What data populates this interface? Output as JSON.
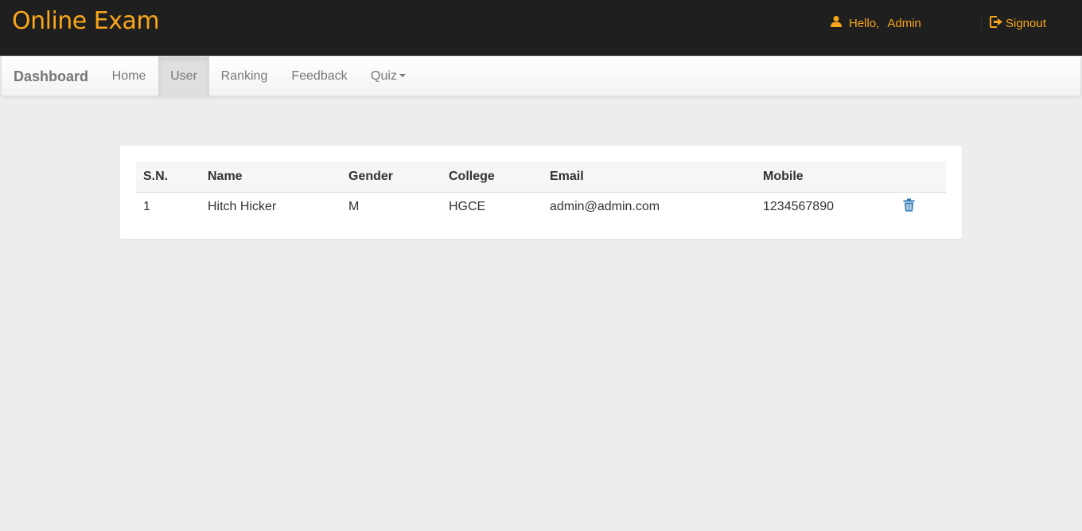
{
  "header": {
    "brand": "Online Exam",
    "greeting": "Hello,",
    "username": "Admin",
    "signout_label": "Signout",
    "accent_color": "#f8a61c",
    "icons": {
      "user": "user-icon",
      "signout": "signout-icon"
    }
  },
  "nav": {
    "brand": "Dashboard",
    "items": [
      {
        "label": "Home"
      },
      {
        "label": "User",
        "active": true
      },
      {
        "label": "Ranking"
      },
      {
        "label": "Feedback"
      },
      {
        "label": "Quiz",
        "has_dropdown": true
      }
    ]
  },
  "table": {
    "columns": [
      "S.N.",
      "Name",
      "Gender",
      "College",
      "Email",
      "Mobile"
    ],
    "rows": [
      {
        "sn": "1",
        "name": "Hitch Hicker",
        "gender": "M",
        "college": "HGCE",
        "email": "admin@admin.com",
        "mobile": "1234567890",
        "action_icon": "trash-icon"
      }
    ],
    "action_color": "#337ab7"
  }
}
